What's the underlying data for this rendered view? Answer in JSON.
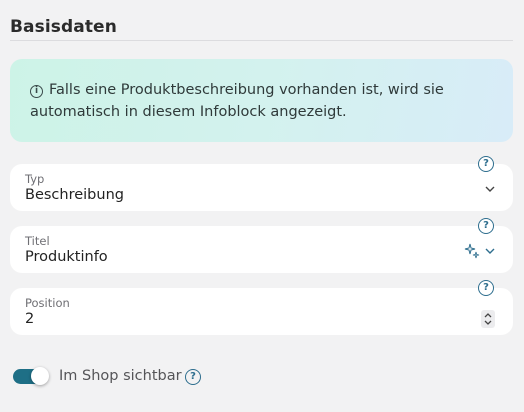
{
  "section": {
    "title": "Basisdaten"
  },
  "info": {
    "icon": "info-icon",
    "text": "Falls eine Produktbeschreibung vorhanden ist, wird sie automatisch in diesem Infoblock angezeigt."
  },
  "fields": {
    "typ": {
      "label": "Typ",
      "value": "Beschreibung",
      "control": "chevron-down-icon",
      "help": "help-icon"
    },
    "titel": {
      "label": "Titel",
      "value": "Produktinfo",
      "control": "chevron-down-icon",
      "extra_icon": "ai-sparkle-icon",
      "help": "help-icon"
    },
    "position": {
      "label": "Position",
      "value": "2",
      "control": "stepper",
      "help": "help-icon"
    }
  },
  "visibility": {
    "label": "Im Shop sichtbar",
    "enabled": true,
    "help": "help-icon"
  },
  "colors": {
    "accent": "#1e6f86",
    "help": "#2e6e8e",
    "info_gradient_start": "#cdf3e7",
    "info_gradient_end": "#d8ecf8",
    "background": "#f2f2f3"
  }
}
